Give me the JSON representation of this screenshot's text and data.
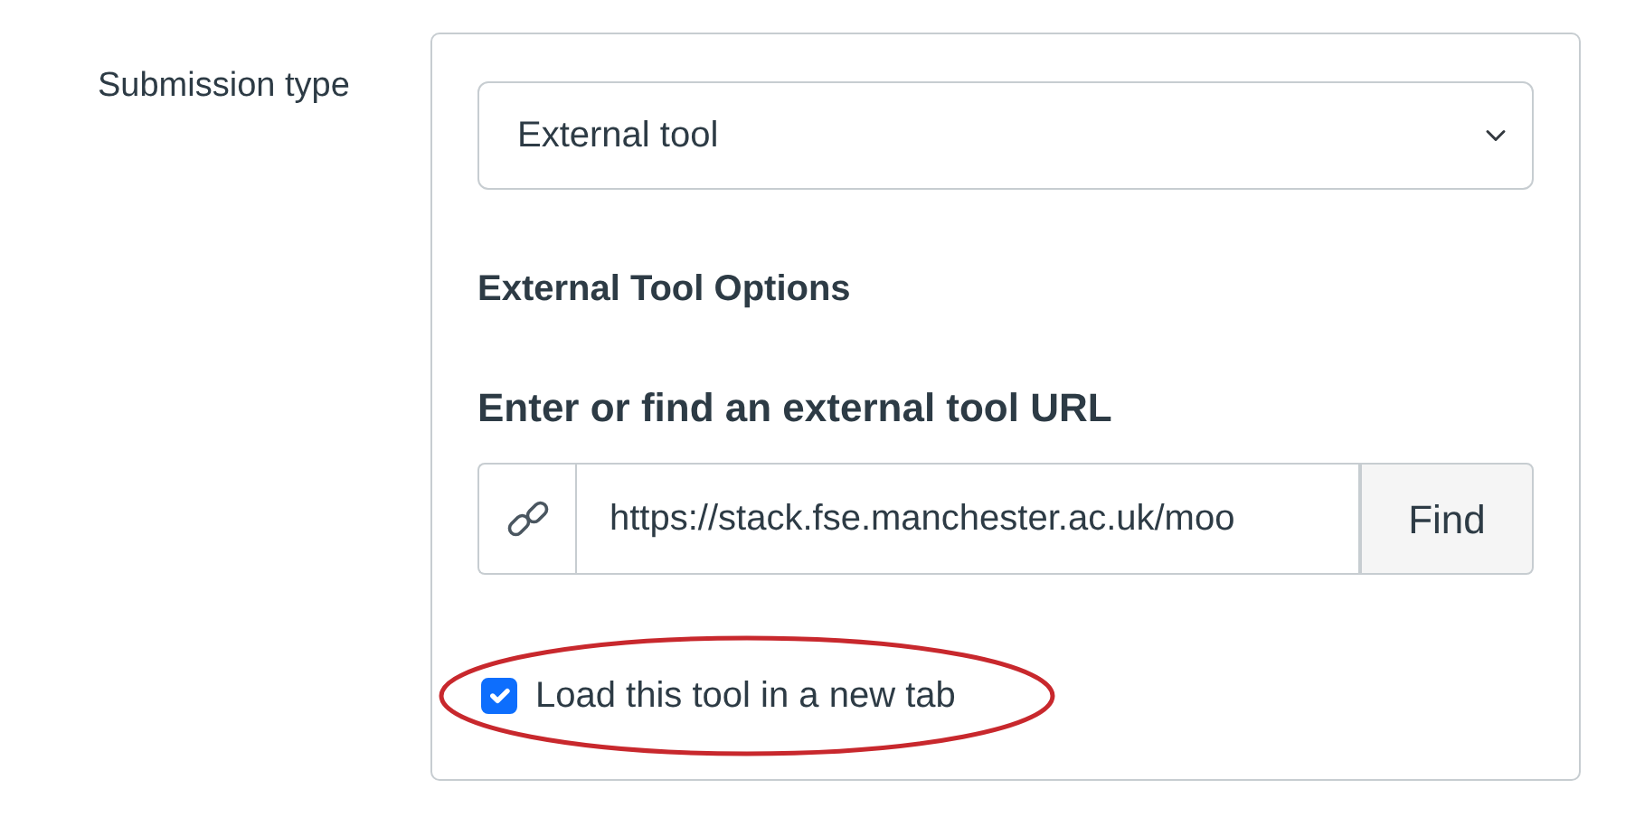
{
  "field_label": "Submission type",
  "submission_select": {
    "value": "External tool"
  },
  "options_heading": "External Tool Options",
  "url_label": "Enter or find an external tool URL",
  "url_field": {
    "value": "https://stack.fse.manchester.ac.uk/moo"
  },
  "find_button": "Find",
  "new_tab_checkbox": {
    "label": "Load this tool in a new tab",
    "checked": true,
    "highlighted": true
  }
}
